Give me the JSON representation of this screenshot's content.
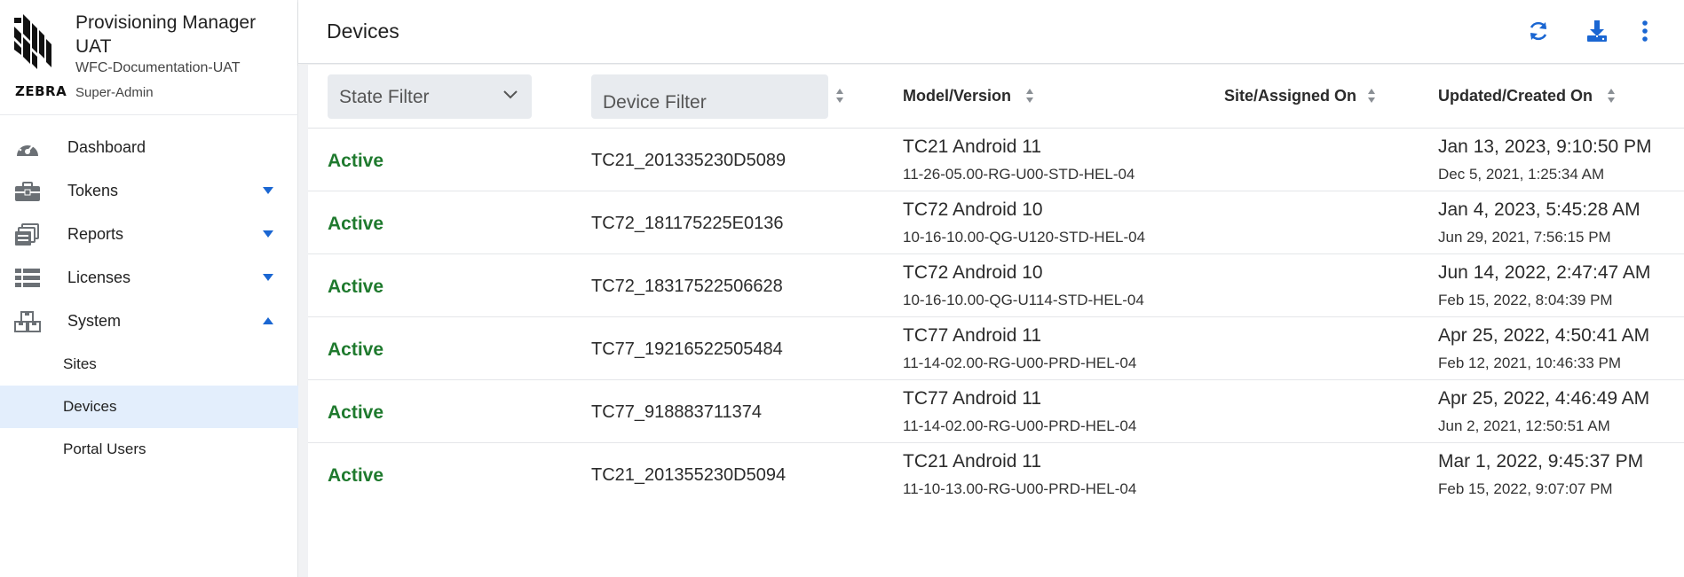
{
  "brand": {
    "logo_word": "ZEBRA",
    "app_title": "Provisioning Manager UAT",
    "tenant": "WFC-Documentation-UAT",
    "role": "Super-Admin"
  },
  "nav": {
    "dashboard": "Dashboard",
    "tokens": "Tokens",
    "reports": "Reports",
    "licenses": "Licenses",
    "system": "System",
    "system_sub": [
      "Sites",
      "Devices",
      "Portal Users"
    ]
  },
  "header": {
    "title": "Devices",
    "refresh_icon": "refresh-icon",
    "download_icon": "download-icon",
    "more_icon": "more-vertical-icon"
  },
  "table": {
    "state_filter_label": "State Filter",
    "device_filter_placeholder": "Device Filter",
    "columns": {
      "model": "Model/Version",
      "site": "Site/Assigned On",
      "updated": "Updated/Created On"
    },
    "rows": [
      {
        "state": "Active",
        "device": "TC21_201335230D5089",
        "model": "TC21 Android 11",
        "version": "11-26-05.00-RG-U00-STD-HEL-04",
        "updated": "Jan 13, 2023, 9:10:50 PM",
        "created": "Dec 5, 2021, 1:25:34 AM"
      },
      {
        "state": "Active",
        "device": "TC72_181175225E0136",
        "model": "TC72 Android 10",
        "version": "10-16-10.00-QG-U120-STD-HEL-04",
        "updated": "Jan 4, 2023, 5:45:28 AM",
        "created": "Jun 29, 2021, 7:56:15 PM"
      },
      {
        "state": "Active",
        "device": "TC72_18317522506628",
        "model": "TC72 Android 10",
        "version": "10-16-10.00-QG-U114-STD-HEL-04",
        "updated": "Jun 14, 2022, 2:47:47 AM",
        "created": "Feb 15, 2022, 8:04:39 PM"
      },
      {
        "state": "Active",
        "device": "TC77_19216522505484",
        "model": "TC77 Android 11",
        "version": "11-14-02.00-RG-U00-PRD-HEL-04",
        "updated": "Apr 25, 2022, 4:50:41 AM",
        "created": "Feb 12, 2021, 10:46:33 PM"
      },
      {
        "state": "Active",
        "device": "TC77_918883711374",
        "model": "TC77 Android 11",
        "version": "11-14-02.00-RG-U00-PRD-HEL-04",
        "updated": "Apr 25, 2022, 4:46:49 AM",
        "created": "Jun 2, 2021, 12:50:51 AM"
      },
      {
        "state": "Active",
        "device": "TC21_201355230D5094",
        "model": "TC21 Android 11",
        "version": "11-10-13.00-RG-U00-PRD-HEL-04",
        "updated": "Mar 1, 2022, 9:45:37 PM",
        "created": "Feb 15, 2022, 9:07:07 PM"
      }
    ]
  },
  "colors": {
    "accent": "#1a66d2",
    "active_state": "#1f7a2e",
    "selected_nav_bg": "#e3eefc"
  }
}
